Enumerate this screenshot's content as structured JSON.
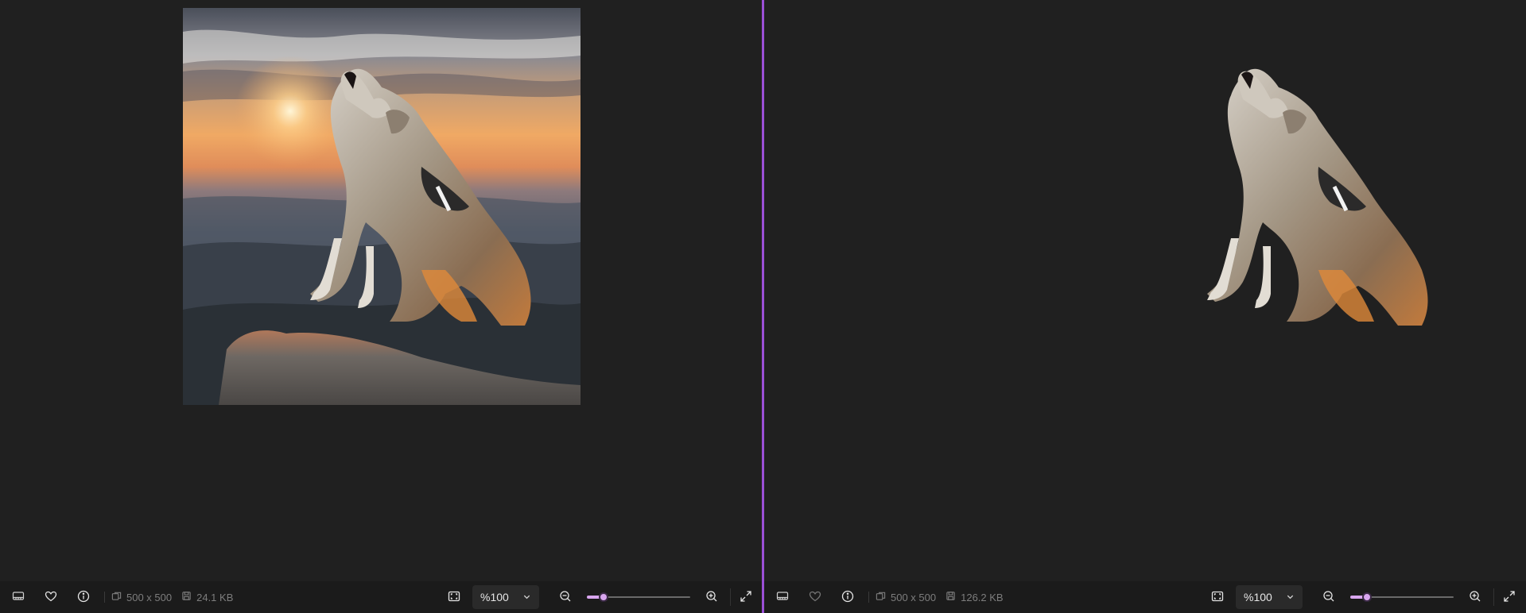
{
  "panes": [
    {
      "id": "original",
      "image_alt": "Wolf howling on rock at sunset",
      "has_background": true,
      "dimensions": "500 x 500",
      "file_size": "24.1 KB",
      "zoom": "%100",
      "zoom_level": 0.16,
      "favorite_enabled": true
    },
    {
      "id": "result",
      "image_alt": "Wolf with background removed",
      "has_background": false,
      "dimensions": "500 x 500",
      "file_size": "126.2 KB",
      "zoom": "%100",
      "zoom_level": 0.16,
      "favorite_enabled": false
    }
  ],
  "colors": {
    "accent": "#d9a6ef",
    "divider": "#9b4fd6",
    "background": "#202020",
    "toolbar": "#1b1b1b"
  },
  "icons": {
    "filmstrip": "filmstrip-icon",
    "favorite": "heart-icon",
    "info": "info-icon",
    "dimensions": "dimensions-icon",
    "filesize": "save-disk-icon",
    "fit": "fit-to-screen-icon",
    "dropdown": "chevron-down-icon",
    "zoom_out": "zoom-out-icon",
    "zoom_in": "zoom-in-icon",
    "fullscreen": "fullscreen-icon"
  }
}
